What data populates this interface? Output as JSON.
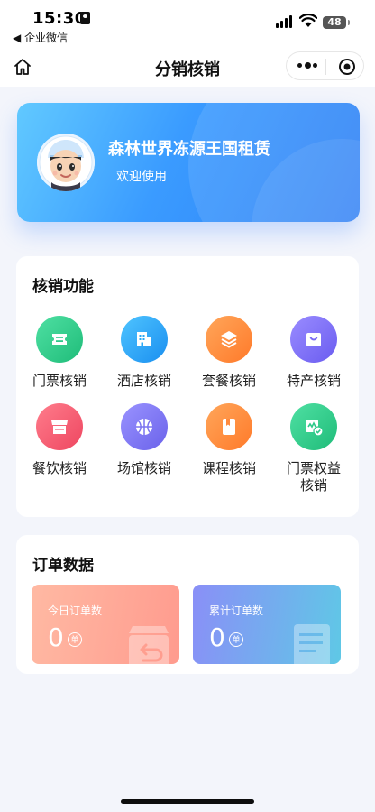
{
  "status_bar": {
    "time": "15:30",
    "back_app": "◀ 企业微信",
    "battery": "48"
  },
  "nav": {
    "title": "分销核销"
  },
  "profile": {
    "company": "森林世界冻源王国租赁",
    "welcome": "欢迎使用"
  },
  "functions": {
    "title": "核销功能",
    "items": [
      {
        "label": "门票核销",
        "icon": "ticket-icon",
        "color": "#2ec98a"
      },
      {
        "label": "酒店核销",
        "icon": "hotel-icon",
        "color": "#2aa8f5"
      },
      {
        "label": "套餐核销",
        "icon": "package-layers-icon",
        "color": "#ff8a3d"
      },
      {
        "label": "特产核销",
        "icon": "shopping-bag-icon",
        "color": "#7b6cf3"
      },
      {
        "label": "餐饮核销",
        "icon": "restaurant-store-icon",
        "color": "#f35a6e"
      },
      {
        "label": "场馆核销",
        "icon": "basketball-icon",
        "color": "#7a72f0"
      },
      {
        "label": "课程核销",
        "icon": "book-icon",
        "color": "#ff8a3d"
      },
      {
        "label": "门票权益核销",
        "label_line1": "门票权益",
        "label_line2": "核销",
        "icon": "ticket-benefit-icon",
        "color": "#2ec98a"
      }
    ]
  },
  "orders": {
    "title": "订单数据",
    "today": {
      "label": "今日订单数",
      "value": "0",
      "unit": "单"
    },
    "total": {
      "label": "累计订单数",
      "value": "0",
      "unit": "单"
    }
  }
}
